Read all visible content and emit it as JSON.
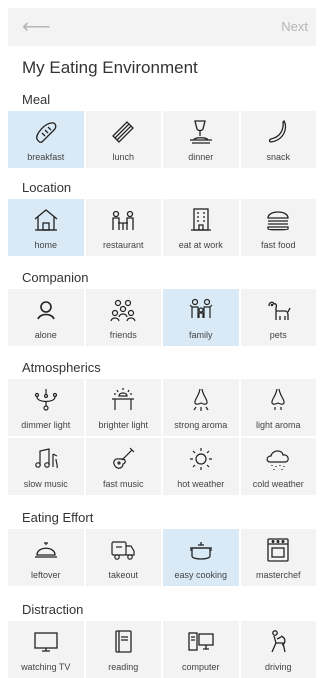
{
  "header": {
    "back_icon": "arrow-left-icon",
    "next_label": "Next"
  },
  "title": "My Eating Environment",
  "sections": {
    "meal": {
      "label": "Meal",
      "items": [
        {
          "label": "breakfast",
          "icon": "bread-icon",
          "selected": true
        },
        {
          "label": "lunch",
          "icon": "sandwich-icon",
          "selected": false
        },
        {
          "label": "dinner",
          "icon": "wine-plate-icon",
          "selected": false
        },
        {
          "label": "snack",
          "icon": "banana-icon",
          "selected": false
        }
      ]
    },
    "location": {
      "label": "Location",
      "items": [
        {
          "label": "home",
          "icon": "house-icon",
          "selected": true
        },
        {
          "label": "restaurant",
          "icon": "dining-table-icon",
          "selected": false
        },
        {
          "label": "eat at work",
          "icon": "office-building-icon",
          "selected": false
        },
        {
          "label": "fast food",
          "icon": "burger-icon",
          "selected": false
        }
      ]
    },
    "companion": {
      "label": "Companion",
      "items": [
        {
          "label": "alone",
          "icon": "person-icon",
          "selected": false
        },
        {
          "label": "friends",
          "icon": "group-icon",
          "selected": false
        },
        {
          "label": "family",
          "icon": "family-icon",
          "selected": true
        },
        {
          "label": "pets",
          "icon": "dog-icon",
          "selected": false
        }
      ]
    },
    "atmospherics": {
      "label": "Atmospherics",
      "items": [
        {
          "label": "dimmer light",
          "icon": "chandelier-icon",
          "selected": false
        },
        {
          "label": "brighter light",
          "icon": "bright-lamp-icon",
          "selected": false
        },
        {
          "label": "strong aroma",
          "icon": "nose-strong-icon",
          "selected": false
        },
        {
          "label": "light aroma",
          "icon": "nose-light-icon",
          "selected": false
        },
        {
          "label": "slow music",
          "icon": "music-notes-icon",
          "selected": false
        },
        {
          "label": "fast music",
          "icon": "guitar-icon",
          "selected": false
        },
        {
          "label": "hot weather",
          "icon": "sun-icon",
          "selected": false
        },
        {
          "label": "cold weather",
          "icon": "snow-cloud-icon",
          "selected": false
        }
      ]
    },
    "eating_effort": {
      "label": "Eating Effort",
      "items": [
        {
          "label": "leftover",
          "icon": "cloche-icon",
          "selected": false
        },
        {
          "label": "takeout",
          "icon": "delivery-truck-icon",
          "selected": false
        },
        {
          "label": "easy cooking",
          "icon": "cooking-pot-icon",
          "selected": true
        },
        {
          "label": "masterchef",
          "icon": "stove-icon",
          "selected": false
        }
      ]
    },
    "distraction": {
      "label": "Distraction",
      "items": [
        {
          "label": "watching TV",
          "icon": "tv-icon",
          "selected": false
        },
        {
          "label": "reading",
          "icon": "book-icon",
          "selected": false
        },
        {
          "label": "computer",
          "icon": "computer-icon",
          "selected": false
        },
        {
          "label": "driving",
          "icon": "driving-icon",
          "selected": false
        }
      ]
    }
  },
  "colors": {
    "tile_bg": "#f3f3f3",
    "selected_bg": "#d9eaf6",
    "muted": "#b5b5b5"
  }
}
